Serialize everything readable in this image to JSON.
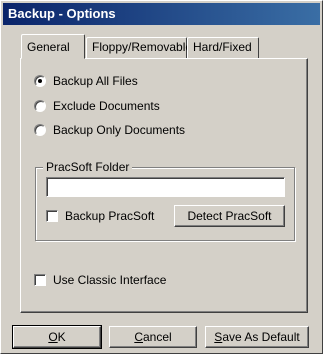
{
  "window": {
    "title": "Backup - Options"
  },
  "tabs": [
    {
      "label": "General",
      "active": true
    },
    {
      "label": "Floppy/Removable",
      "active": false
    },
    {
      "label": "Hard/Fixed",
      "active": false
    }
  ],
  "backup_mode": {
    "options": [
      {
        "label": "Backup All Files",
        "checked": true
      },
      {
        "label": "Exclude Documents",
        "checked": false
      },
      {
        "label": "Backup Only Documents",
        "checked": false
      }
    ]
  },
  "pracsoft_group": {
    "title": "PracSoft Folder",
    "folder_value": "",
    "backup_checkbox_label": "Backup PracSoft",
    "backup_checked": false,
    "detect_button": "Detect PracSoft"
  },
  "classic_interface": {
    "label": "Use Classic Interface",
    "checked": false
  },
  "footer": {
    "ok": {
      "mnemonic": "O",
      "rest": "K"
    },
    "cancel": {
      "mnemonic": "C",
      "rest": "ancel"
    },
    "save_default": {
      "mnemonic": "S",
      "rest": "ave As Default"
    }
  }
}
